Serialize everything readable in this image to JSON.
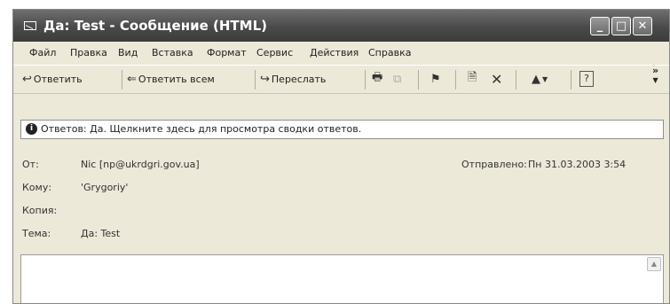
{
  "window": {
    "title": "Да: Test - Сообщение (HTML)"
  },
  "window_controls": {
    "minimize": "_",
    "maximize": "□",
    "close": "✕"
  },
  "menu": [
    "Файл",
    "Правка",
    "Вид",
    "Вставка",
    "Формат",
    "Сервис",
    "Действия",
    "Справка"
  ],
  "toolbar": {
    "reply": "Ответить",
    "reply_all": "Ответить всем",
    "forward": "Переслать",
    "more": "»"
  },
  "infobar": {
    "text": "Ответов: Да.  Щелкните здесь для просмотра сводки ответов."
  },
  "headers": {
    "from_label": "От:",
    "from_value": "Nic [np@ukrdgri.gov.ua]",
    "sent_label": "Отправлено:",
    "sent_value": "Пн 31.03.2003 3:54",
    "to_label": "Кому:",
    "to_value": "'Grygoriy'",
    "cc_label": "Копия:",
    "subject_label": "Тема:",
    "subject_value": "Да: Test"
  }
}
